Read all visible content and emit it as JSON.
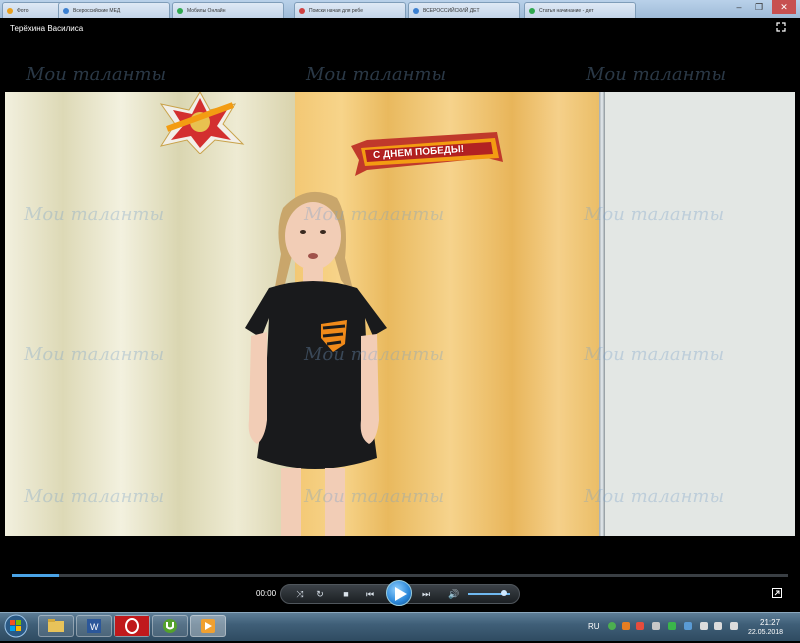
{
  "browser": {
    "tabs": [
      {
        "label": "Фото",
        "color": "#e8a020"
      },
      {
        "label": "Всероссийские МЕД",
        "color": "#3b7fd0"
      },
      {
        "label": "Мобилы Онлайн",
        "color": "#2fa84f"
      },
      {
        "label": "Поиски начая для ребе",
        "color": "#d04040"
      },
      {
        "label": "ВСЕРОССИЙСКИЙ ДЕТ",
        "color": "#3b7fd0"
      },
      {
        "label": "Статья начинание - дет",
        "color": "#2fa84f"
      }
    ],
    "minimize_label": "–",
    "maximize_label": "❐",
    "close_label": "✕"
  },
  "player": {
    "title": "Терёхина Василиса",
    "watermark": "Мои таланты",
    "banner_text": "С ДНЕМ ПОБЕДЫ!",
    "elapsed": "00:00",
    "progress_fraction": 0.06,
    "volume_fraction": 0.85,
    "icons": {
      "fullscreen": "fullscreen-icon",
      "shuffle": "shuffle-icon",
      "repeat": "repeat-icon",
      "stop": "stop-icon",
      "previous": "previous-icon",
      "play": "play-icon",
      "next": "next-icon",
      "volume": "volume-icon",
      "switch_view": "switch-view-icon"
    }
  },
  "taskbar": {
    "language": "RU",
    "time": "21:27",
    "date": "22.05.2018",
    "apps": [
      "file-explorer",
      "word",
      "opera",
      "utorrent",
      "media-player"
    ]
  }
}
